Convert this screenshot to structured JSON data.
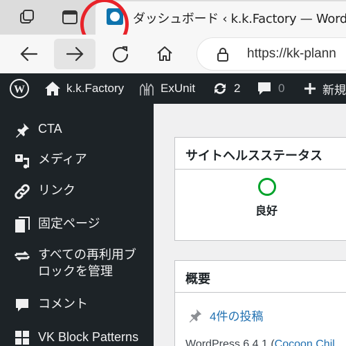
{
  "browser": {
    "active_tab_title": "ダッシュボード ‹ k.k.Factory — Word",
    "url": "https://kk-plann"
  },
  "admin_bar": {
    "site_name": "k.k.Factory",
    "exunit": "ExUnit",
    "updates_count": "2",
    "comments_count": "0",
    "new_label": "新規"
  },
  "sidebar": {
    "items": [
      {
        "label": "CTA",
        "icon": "pin-icon"
      },
      {
        "label": "メディア",
        "icon": "media-icon"
      },
      {
        "label": "リンク",
        "icon": "link-icon"
      },
      {
        "label": "固定ページ",
        "icon": "page-icon"
      },
      {
        "label": "すべての再利用ブロックを管理",
        "icon": "reusable-blocks-icon"
      },
      {
        "label": "コメント",
        "icon": "comment-icon"
      },
      {
        "label": "VK Block Patterns",
        "icon": "patterns-icon"
      }
    ]
  },
  "site_health": {
    "title": "サイトヘルスステータス",
    "status": "良好",
    "status_color": "#00a32a"
  },
  "overview": {
    "title": "概要",
    "posts_link": "4件の投稿",
    "version_prefix": "WordPress 6.4.1 (",
    "theme_link": "Cocoon Chil"
  },
  "colors": {
    "admin_dark": "#1d2327",
    "link_blue": "#2271b1",
    "annotation_red": "#e8232a"
  }
}
